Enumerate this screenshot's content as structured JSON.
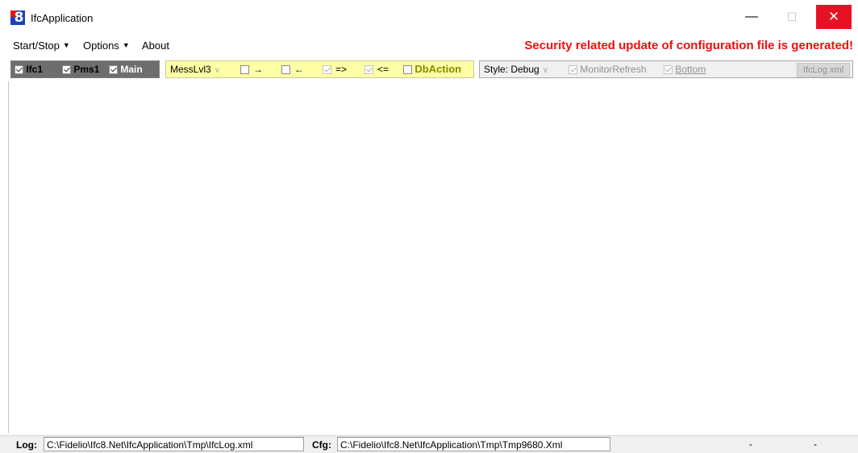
{
  "window": {
    "title": "IfcApplication",
    "icon_digit": "8",
    "icon": "ifc8-app-icon",
    "minimize": "—",
    "maximize": "☐",
    "close": "✕"
  },
  "menu": {
    "items": [
      "Start/Stop",
      "Options",
      "About"
    ],
    "notice": "Security related update of configuration file is generated!",
    "notice_color": "#f20d0d"
  },
  "toolbar": {
    "dark_group": [
      {
        "label": "Ifc1",
        "checked": true
      },
      {
        "label": "Pms1",
        "checked": true
      },
      {
        "label": "Main",
        "checked": true
      }
    ],
    "yellow_group": {
      "level": "MessLvl3",
      "toggles": [
        {
          "label": "→",
          "checked": false
        },
        {
          "label": "←",
          "checked": false
        },
        {
          "label": "=>",
          "checked": true
        },
        {
          "label": "<=",
          "checked": true
        },
        {
          "label": "DbAction",
          "checked": false
        }
      ]
    },
    "gray_group": {
      "style": "Style: Debug",
      "monitor_refresh": "MonitorRefresh",
      "bottom": "Bottom",
      "log_file": "IfcLog.xml"
    }
  },
  "status": {
    "log_label": "Log:",
    "log_path": "C:\\Fidelio\\Ifc8.Net\\IfcApplication\\Tmp\\IfcLog.xml",
    "cfg_label": "Cfg:",
    "cfg_path": "C:\\Fidelio\\Ifc8.Net\\IfcApplication\\Tmp\\Tmp9680.Xml",
    "field3": "-",
    "field4": "-"
  }
}
